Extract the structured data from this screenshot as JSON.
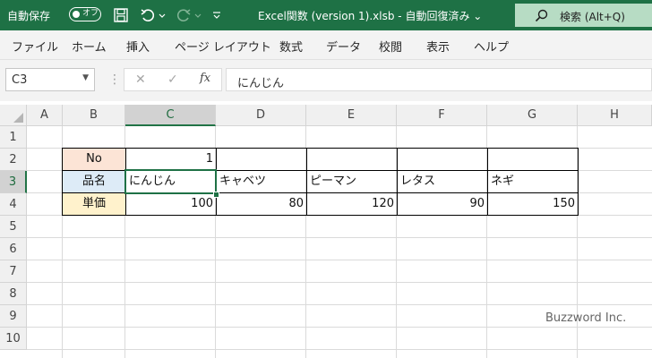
{
  "titlebar": {
    "autosave_label": "自動保存",
    "autosave_state": "オフ",
    "doc_title": "Excel関数 (version 1).xlsb  -  自動回復済み  ⌄",
    "search_label": "検索 (Alt+Q)"
  },
  "ribbon": {
    "tabs": [
      "ファイル",
      "ホーム",
      "挿入",
      "ページ レイアウト",
      "数式",
      "データ",
      "校閲",
      "表示",
      "ヘルプ"
    ]
  },
  "formula_bar": {
    "name_box": "C3",
    "cancel_glyph": "✕",
    "enter_glyph": "✓",
    "fx_label": "fx",
    "content": "にんじん"
  },
  "sheet": {
    "columns": [
      "A",
      "B",
      "C",
      "D",
      "E",
      "F",
      "G",
      "H"
    ],
    "rows": [
      "1",
      "2",
      "3",
      "4",
      "5",
      "6",
      "7",
      "8",
      "9",
      "10"
    ],
    "table": {
      "row_no": {
        "header": "No",
        "values": [
          "1",
          "",
          "",
          "",
          ""
        ]
      },
      "row_name": {
        "header": "品名",
        "values": [
          "にんじん",
          "キャベツ",
          "ピーマン",
          "レタス",
          "ネギ"
        ]
      },
      "row_price": {
        "header": "単価",
        "values": [
          "100",
          "80",
          "120",
          "90",
          "150"
        ]
      }
    },
    "header_colors": {
      "no": "#fce4d6",
      "name": "#ddebf7",
      "price": "#fff2cc"
    }
  },
  "watermark": "Buzzword Inc.",
  "accent_color": "#1e7145"
}
